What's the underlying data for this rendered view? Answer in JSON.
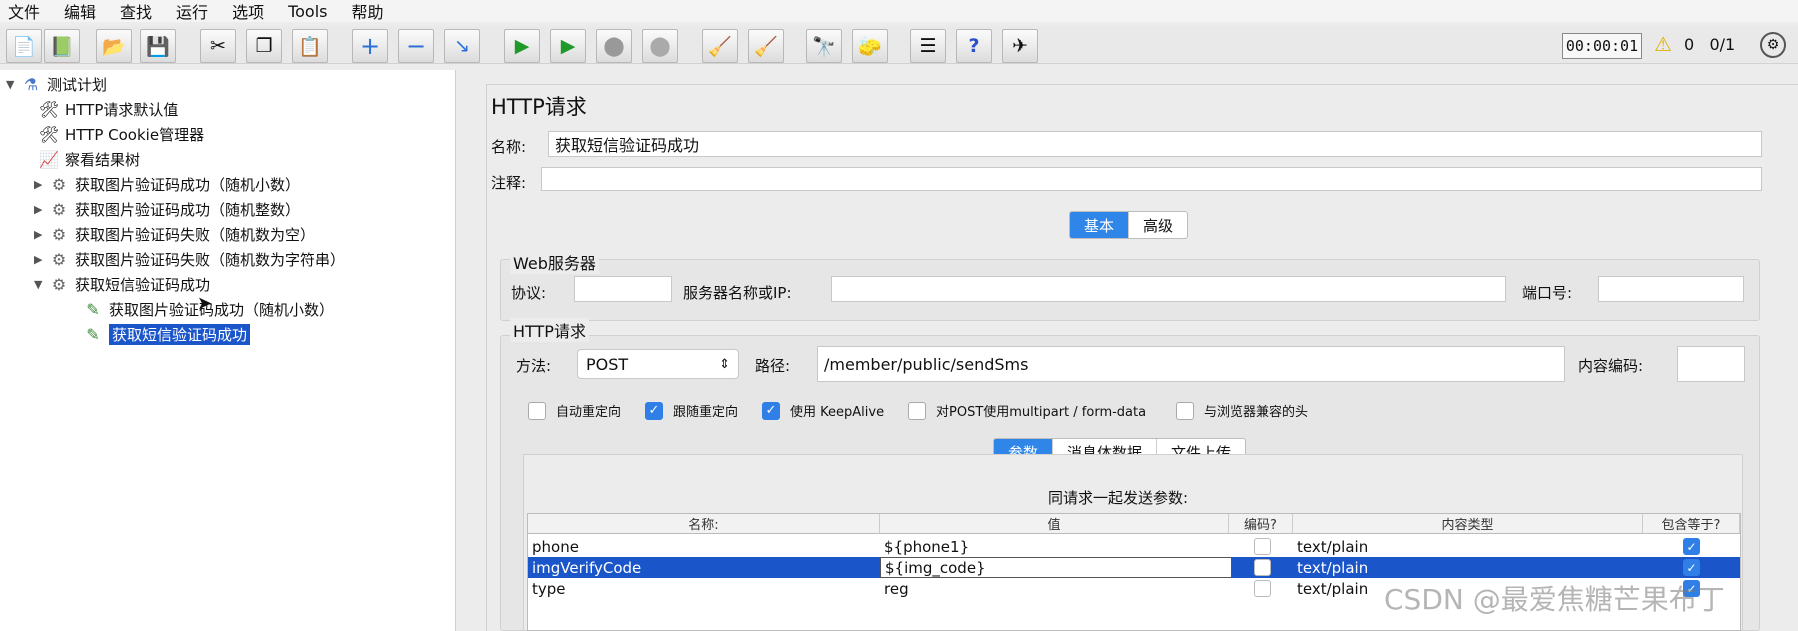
{
  "menu": [
    "文件",
    "编辑",
    "查找",
    "运行",
    "选项",
    "Tools",
    "帮助"
  ],
  "toolbar": {
    "timer": "00:00:01",
    "warning_count": "0",
    "thread_ratio": "0/1",
    "icons": [
      "new-icon",
      "templates-icon",
      "open-icon",
      "save-icon",
      "cut-icon",
      "copy-icon",
      "paste-icon",
      "expand-icon",
      "collapse-icon",
      "toggle-icon",
      "start-icon",
      "start-no-pause-icon",
      "stop-icon",
      "shutdown-icon",
      "clear-icon",
      "clear-all-icon",
      "search-icon",
      "reset-search-icon",
      "function-helper-icon",
      "help-icon",
      "remote-icon"
    ]
  },
  "tree": [
    {
      "label": "测试计划",
      "icon": "flask-icon",
      "arrow": "▼"
    },
    {
      "label": "HTTP请求默认值",
      "icon": "wrench-icon",
      "arrow": ""
    },
    {
      "label": "HTTP Cookie管理器",
      "icon": "wrench-icon",
      "arrow": ""
    },
    {
      "label": "察看结果树",
      "icon": "chart-icon",
      "arrow": ""
    },
    {
      "label": "获取图片验证码成功（随机小数）",
      "icon": "gear-icon",
      "arrow": "▶"
    },
    {
      "label": "获取图片验证码成功（随机整数）",
      "icon": "gear-icon",
      "arrow": "▶"
    },
    {
      "label": "获取图片验证码失败（随机数为空）",
      "icon": "gear-icon",
      "arrow": "▶"
    },
    {
      "label": "获取图片验证码失败（随机数为字符串）",
      "icon": "gear-icon",
      "arrow": "▶"
    },
    {
      "label": "获取短信验证码成功",
      "icon": "gear-icon",
      "arrow": "▼"
    },
    {
      "label": "获取图片验证码成功（随机小数）",
      "icon": "pipette-icon",
      "arrow": ""
    },
    {
      "label": "获取短信验证码成功",
      "icon": "pipette-icon",
      "arrow": ""
    }
  ],
  "panel": {
    "title": "HTTP请求",
    "name_label": "名称:",
    "name_value": "获取短信验证码成功",
    "comment_label": "注释:",
    "comment_value": "",
    "tabs": [
      "基本",
      "高级"
    ],
    "web_server": {
      "title": "Web服务器",
      "protocol_label": "协议:",
      "server_label": "服务器名称或IP:",
      "port_label": "端口号:",
      "protocol_value": "",
      "server_value": "",
      "port_value": ""
    },
    "http": {
      "title": "HTTP请求",
      "method_label": "方法:",
      "method_value": "POST",
      "path_label": "路径:",
      "path_value": "/member/public/sendSms",
      "encoding_label": "内容编码:",
      "encoding_value": ""
    },
    "options": [
      {
        "label": "自动重定向",
        "checked": false
      },
      {
        "label": "跟随重定向",
        "checked": true
      },
      {
        "label": "使用 KeepAlive",
        "checked": true
      },
      {
        "label": "对POST使用multipart / form-data",
        "checked": false
      },
      {
        "label": "与浏览器兼容的头",
        "checked": false
      }
    ],
    "sub_tabs": [
      "参数",
      "消息体数据",
      "文件上传"
    ],
    "params_title": "同请求一起发送参数:",
    "columns": [
      "名称:",
      "值",
      "编码?",
      "内容类型",
      "包含等于?"
    ],
    "rows": [
      {
        "name": "phone",
        "value": "${phone1}",
        "encode": false,
        "content_type": "text/plain",
        "include_equals": true
      },
      {
        "name": "imgVerifyCode",
        "value": "${img_code}",
        "encode": false,
        "content_type": "text/plain",
        "include_equals": true
      },
      {
        "name": "type",
        "value": "reg",
        "encode": false,
        "content_type": "text/plain",
        "include_equals": true
      }
    ]
  },
  "watermark": "CSDN @最爱焦糖芒果布丁",
  "colors": {
    "selection": "#1a55c9",
    "tab_active": "#2f86e8",
    "checkbox": "#2f7fe6"
  }
}
